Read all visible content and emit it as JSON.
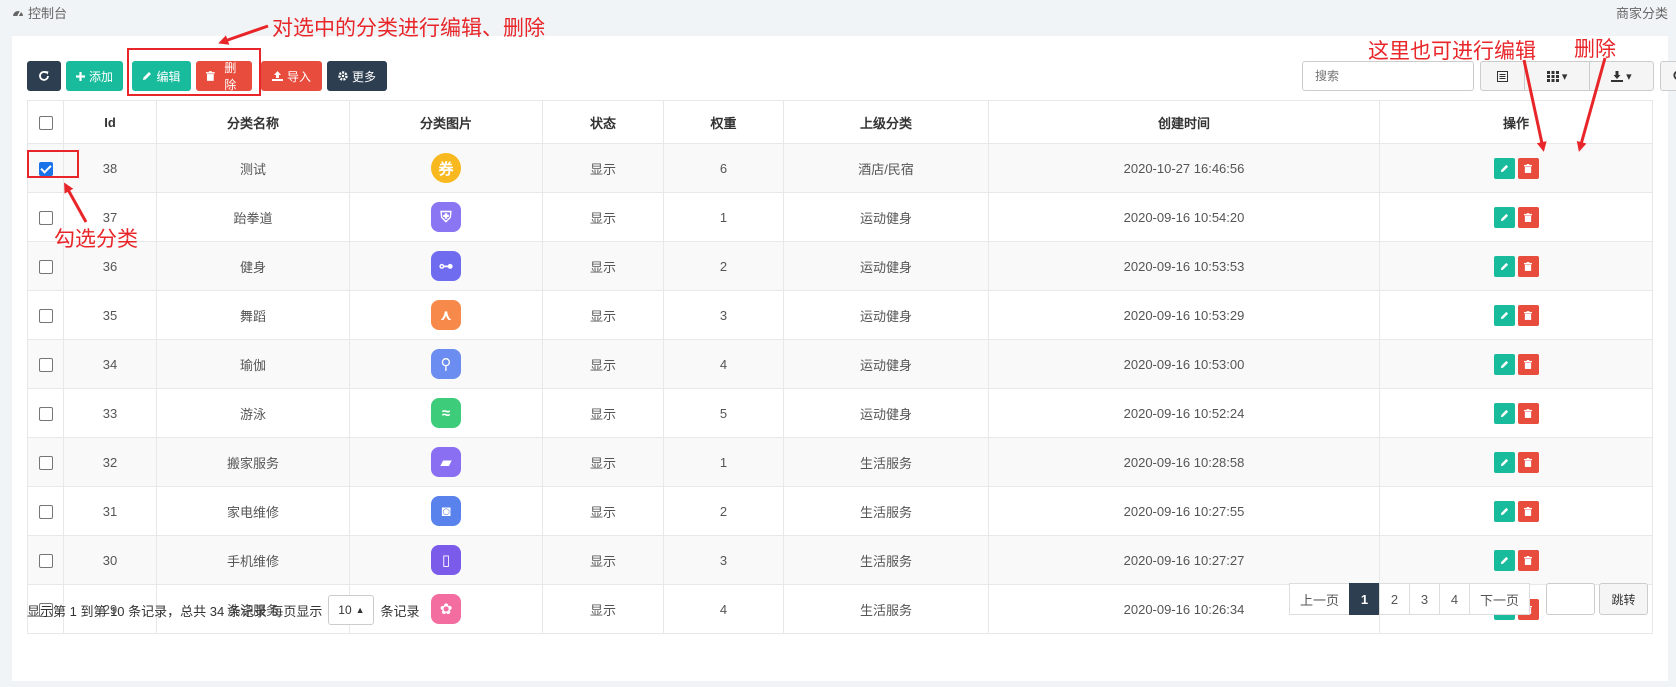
{
  "breadcrumb": "控制台",
  "page_title": "商家分类",
  "toolbar": {
    "refresh": "",
    "add": "添加",
    "edit": "编辑",
    "delete": "删除",
    "import": "导入",
    "more": "更多"
  },
  "search": {
    "placeholder": "搜索"
  },
  "table": {
    "headers": [
      "Id",
      "分类名称",
      "分类图片",
      "状态",
      "权重",
      "上级分类",
      "创建时间",
      "操作"
    ],
    "rows": [
      {
        "id": "38",
        "name": "测试",
        "status": "显示",
        "weight": "6",
        "parent": "酒店/民宿",
        "created": "2020-10-27 16:46:56",
        "checked": true,
        "icon": "coupon-icon",
        "color": "#f7b91f"
      },
      {
        "id": "37",
        "name": "跆拳道",
        "status": "显示",
        "weight": "1",
        "parent": "运动健身",
        "created": "2020-09-16 10:54:20",
        "checked": false,
        "icon": "taekwondo-icon",
        "color": "#8a76f2"
      },
      {
        "id": "36",
        "name": "健身",
        "status": "显示",
        "weight": "2",
        "parent": "运动健身",
        "created": "2020-09-16 10:53:53",
        "checked": false,
        "icon": "dumbbell-icon",
        "color": "#6f6cf0"
      },
      {
        "id": "35",
        "name": "舞蹈",
        "status": "显示",
        "weight": "3",
        "parent": "运动健身",
        "created": "2020-09-16 10:53:29",
        "checked": false,
        "icon": "dance-icon",
        "color": "#f78a4a"
      },
      {
        "id": "34",
        "name": "瑜伽",
        "status": "显示",
        "weight": "4",
        "parent": "运动健身",
        "created": "2020-09-16 10:53:00",
        "checked": false,
        "icon": "yoga-icon",
        "color": "#6b8cf0"
      },
      {
        "id": "33",
        "name": "游泳",
        "status": "显示",
        "weight": "5",
        "parent": "运动健身",
        "created": "2020-09-16 10:52:24",
        "checked": false,
        "icon": "swim-icon",
        "color": "#3dcc7a"
      },
      {
        "id": "32",
        "name": "搬家服务",
        "status": "显示",
        "weight": "1",
        "parent": "生活服务",
        "created": "2020-09-16 10:28:58",
        "checked": false,
        "icon": "truck-icon",
        "color": "#8a6ff2"
      },
      {
        "id": "31",
        "name": "家电维修",
        "status": "显示",
        "weight": "2",
        "parent": "生活服务",
        "created": "2020-09-16 10:27:55",
        "checked": false,
        "icon": "appliance-icon",
        "color": "#5a82ec"
      },
      {
        "id": "30",
        "name": "手机维修",
        "status": "显示",
        "weight": "3",
        "parent": "生活服务",
        "created": "2020-09-16 10:27:27",
        "checked": false,
        "icon": "phone-icon",
        "color": "#7b5bea"
      },
      {
        "id": "29",
        "name": "洗涤服务",
        "status": "显示",
        "weight": "4",
        "parent": "生活服务",
        "created": "2020-09-16 10:26:34",
        "checked": false,
        "icon": "laundry-icon",
        "color": "#f46da0"
      }
    ]
  },
  "footer": {
    "info_prefix": "显示第 1 到第 10 条记录，总共 34 条记录 每页显示",
    "page_size": "10",
    "info_suffix": "条记录"
  },
  "pager": {
    "prev": "上一页",
    "pages": [
      "1",
      "2",
      "3",
      "4"
    ],
    "next": "下一页",
    "goto": "跳转"
  },
  "annotations": {
    "top": "对选中的分类进行编辑、删除",
    "right_edit": "这里也可进行编辑",
    "right_delete": "删除",
    "check": "勾选分类"
  }
}
